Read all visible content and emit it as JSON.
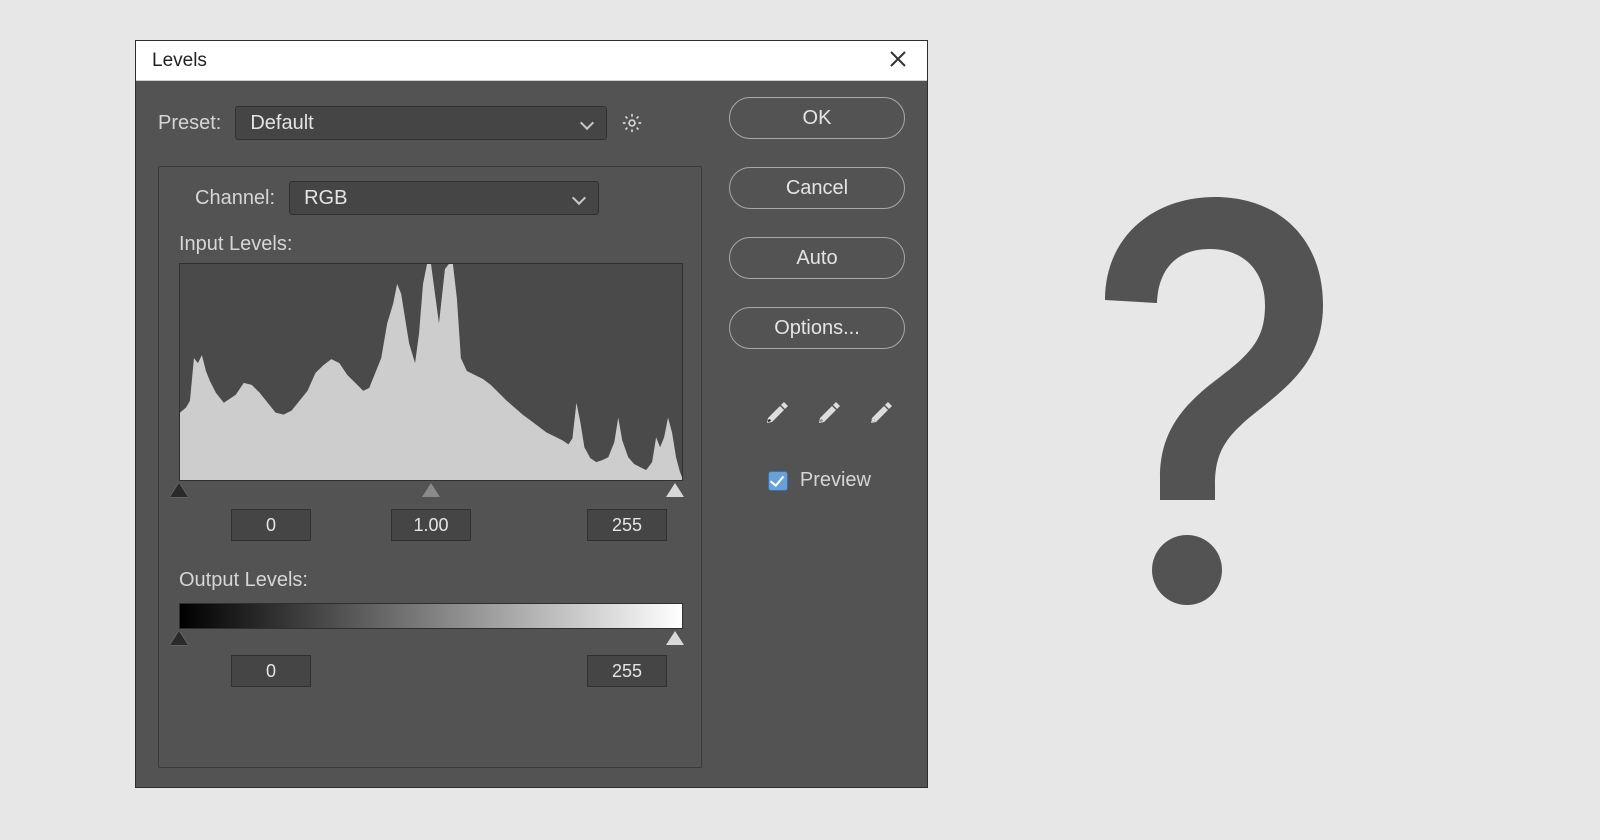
{
  "window": {
    "title": "Levels"
  },
  "preset": {
    "label": "Preset:",
    "value": "Default"
  },
  "channel": {
    "label": "Channel:",
    "value": "RGB"
  },
  "input_levels": {
    "label": "Input Levels:",
    "black": "0",
    "gamma": "1.00",
    "white": "255"
  },
  "output_levels": {
    "label": "Output Levels:",
    "black": "0",
    "white": "255"
  },
  "buttons": {
    "ok": "OK",
    "cancel": "Cancel",
    "auto": "Auto",
    "options": "Options..."
  },
  "preview": {
    "label": "Preview",
    "checked": true
  },
  "icons": {
    "close": "close-icon",
    "gear": "gear-icon",
    "eyedropper_black": "black-point-eyedropper-icon",
    "eyedropper_gray": "gray-point-eyedropper-icon",
    "eyedropper_white": "white-point-eyedropper-icon"
  }
}
